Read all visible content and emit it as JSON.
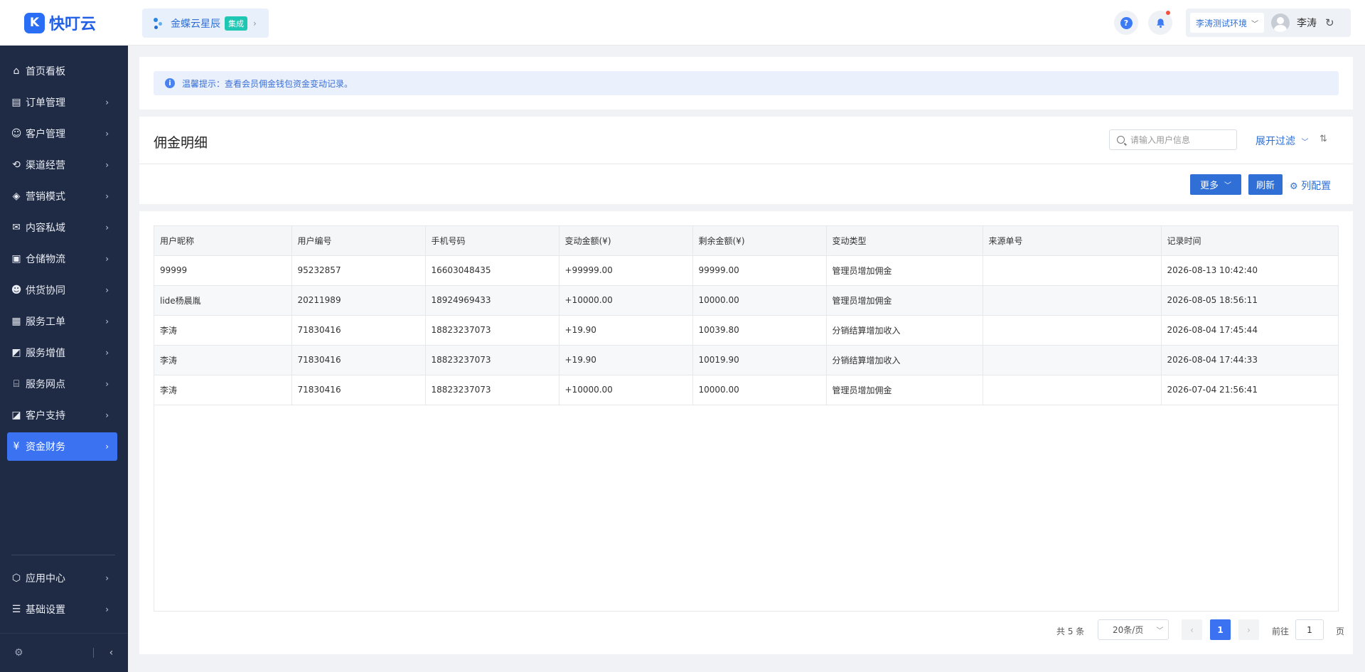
{
  "logo": {
    "mark": "K",
    "text": "快叮云"
  },
  "sidebar": {
    "items": [
      {
        "label": "首页看板",
        "icon": "home-icon",
        "glyph": "⌂",
        "has_children": false
      },
      {
        "label": "订单管理",
        "icon": "order-icon",
        "glyph": "▤",
        "has_children": true
      },
      {
        "label": "客户管理",
        "icon": "user-icon",
        "glyph": "☺",
        "has_children": true
      },
      {
        "label": "渠道经营",
        "icon": "channel-icon",
        "glyph": "⟲",
        "has_children": true
      },
      {
        "label": "营销模式",
        "icon": "tag-icon",
        "glyph": "◈",
        "has_children": true
      },
      {
        "label": "内容私域",
        "icon": "mail-icon",
        "glyph": "✉",
        "has_children": true
      },
      {
        "label": "仓储物流",
        "icon": "warehouse-icon",
        "glyph": "▣",
        "has_children": true
      },
      {
        "label": "供货协同",
        "icon": "supplier-icon",
        "glyph": "☻",
        "has_children": true
      },
      {
        "label": "服务工单",
        "icon": "ticket-icon",
        "glyph": "▦",
        "has_children": true
      },
      {
        "label": "服务增值",
        "icon": "bag-icon",
        "glyph": "◩",
        "has_children": true
      },
      {
        "label": "服务网点",
        "icon": "store-icon",
        "glyph": "⌸",
        "has_children": true
      },
      {
        "label": "客户支持",
        "icon": "support-icon",
        "glyph": "◪",
        "has_children": true
      },
      {
        "label": "资金财务",
        "icon": "yuan-icon",
        "glyph": "¥",
        "has_children": true,
        "active": true
      }
    ],
    "bottom_items": [
      {
        "label": "应用中心",
        "icon": "cube-icon",
        "glyph": "⬡"
      },
      {
        "label": "基础设置",
        "icon": "settings-list-icon",
        "glyph": "☰"
      }
    ]
  },
  "header": {
    "brand_name": "金蝶云星辰",
    "brand_tag": "集成",
    "env_label": "李涛测试环境",
    "user_name": "李涛",
    "has_notification": true
  },
  "tip": {
    "text": "温馨提示：查看会员佣金钱包资金变动记录。"
  },
  "title_panel": {
    "title": "佣金明细",
    "search_placeholder": "请输入用户信息",
    "expand_filter": "展开过滤",
    "more_label": "更多",
    "refresh_label": "刷新",
    "column_config": "列配置"
  },
  "table": {
    "columns": [
      "用户昵称",
      "用户编号",
      "手机号码",
      "变动金额(¥)",
      "剩余金额(¥)",
      "变动类型",
      "来源单号",
      "记录时间"
    ],
    "rows": [
      [
        "99999",
        "95232857",
        "16603048435",
        "+99999.00",
        "99999.00",
        "管理员增加佣金",
        "",
        "2026-08-13 10:42:40"
      ],
      [
        "lide杨晨胤",
        "20211989",
        "18924969433",
        "+10000.00",
        "10000.00",
        "管理员增加佣金",
        "",
        "2026-08-05 18:56:11"
      ],
      [
        "李涛",
        "71830416",
        "18823237073",
        "+19.90",
        "10039.80",
        "分销结算增加收入",
        "",
        "2026-08-04 17:45:44"
      ],
      [
        "李涛",
        "71830416",
        "18823237073",
        "+19.90",
        "10019.90",
        "分销结算增加收入",
        "",
        "2026-08-04 17:44:33"
      ],
      [
        "李涛",
        "71830416",
        "18823237073",
        "+10000.00",
        "10000.00",
        "管理员增加佣金",
        "",
        "2026-07-04 21:56:41"
      ]
    ]
  },
  "pagination": {
    "total_text": "共 5 条",
    "page_size": "20条/页",
    "current_page": "1",
    "goto_label": "前往",
    "goto_value": "1",
    "page_unit": "页"
  },
  "colors": {
    "primary": "#2f6fd6",
    "sidebar_bg": "#1f2a44",
    "active_item": "#3b72f2",
    "tag": "#1ec7b3"
  }
}
